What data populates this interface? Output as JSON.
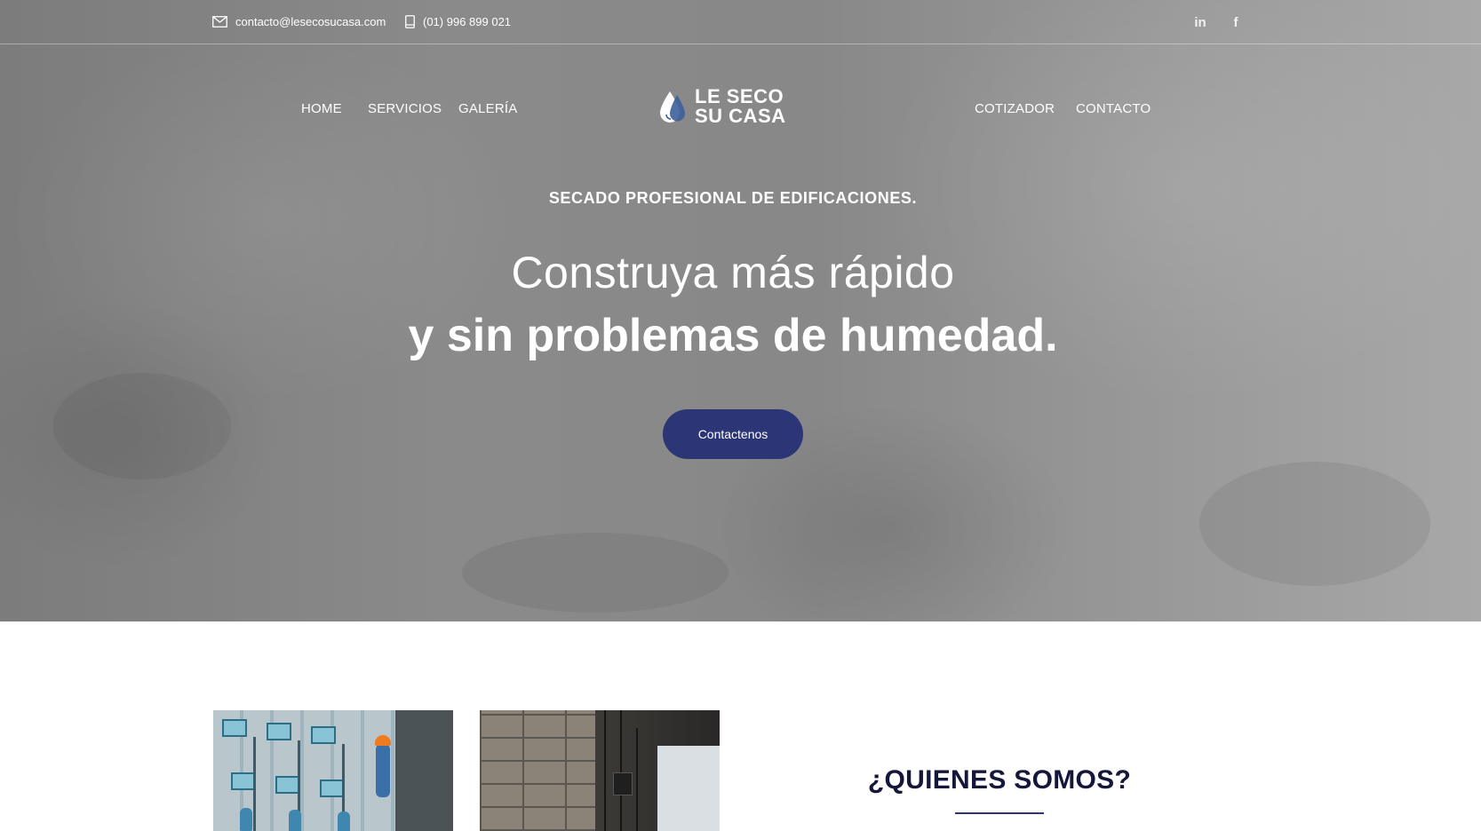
{
  "topbar": {
    "email": "contacto@lesecosucasa.com",
    "phone": "(01) 996 899 021",
    "social": [
      {
        "name": "linkedin",
        "glyph": "in"
      },
      {
        "name": "facebook",
        "glyph": "f"
      }
    ]
  },
  "nav": {
    "left": [
      "HOME",
      "SERVICIOS",
      "GALERÍA"
    ],
    "right": [
      "COTIZADOR",
      "CONTACTO"
    ]
  },
  "logo": {
    "line1": "LE SECO",
    "line2": "SU CASA",
    "icon": "water-drop-icon"
  },
  "hero": {
    "tagline": "SECADO PROFESIONAL DE EDIFICACIONES.",
    "headline_line1": "Construya más rápido",
    "headline_line2": "y sin problemas de humedad.",
    "cta_label": "Contactenos"
  },
  "about": {
    "title": "¿QUIENES SOMOS?"
  },
  "colors": {
    "brand_navy": "#2c3575",
    "title_dark": "#14163a",
    "hero_gray": "#8a8a8a"
  }
}
